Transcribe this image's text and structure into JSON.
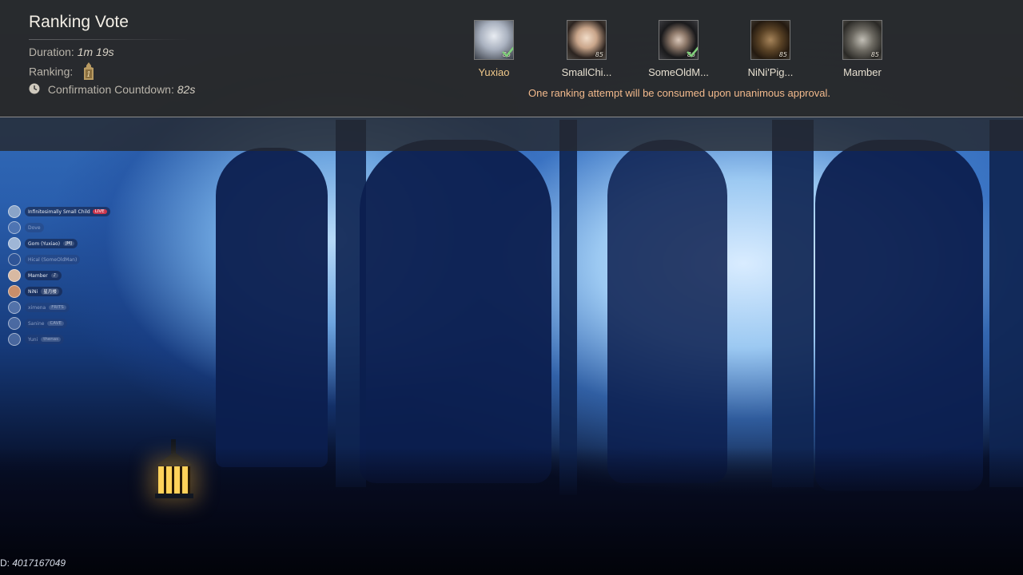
{
  "header": {
    "title": "Ranking Vote",
    "duration_label": "Duration:",
    "duration_value": "1m 19s",
    "ranking_label": "Ranking:",
    "ranking_icon": "rank-1-tablet-icon",
    "countdown_label": "Confirmation Countdown:",
    "countdown_value": "82s",
    "countdown_icon": "clock-icon"
  },
  "players": [
    {
      "name": "Yuxiao",
      "level": "86",
      "approved": true
    },
    {
      "name": "SmallChi...",
      "level": "85",
      "approved": false
    },
    {
      "name": "SomeOldM...",
      "level": "86",
      "approved": true
    },
    {
      "name": "NiNi'Pig...",
      "level": "85",
      "approved": false
    },
    {
      "name": "Mamber",
      "level": "85",
      "approved": false
    }
  ],
  "notice": "One ranking attempt will be consumed upon unanimous approval.",
  "voice_list": [
    {
      "name": "Infinitesimally Small Child",
      "tag": "LIVE",
      "active": true
    },
    {
      "name": "Dove",
      "tag": "",
      "active": false
    },
    {
      "name": "Gom (Yuxiao)",
      "tag": "JMJ",
      "active": true
    },
    {
      "name": "Hical (SomeOldMan)",
      "tag": "",
      "active": false
    },
    {
      "name": "Mamber",
      "tag": "♪",
      "active": true
    },
    {
      "name": "NiNi",
      "tag": "星月楼",
      "active": true
    },
    {
      "name": "ximena",
      "tag": "FRITS",
      "active": false
    },
    {
      "name": "Sanine",
      "tag": "CAVE",
      "active": false
    },
    {
      "name": "Yuni",
      "tag": "thenas",
      "active": false
    }
  ],
  "footer": {
    "id_label": "D:",
    "id_value": "4017167049"
  },
  "colors": {
    "panel_bg": "#282828",
    "accent_text": "#f2b98c",
    "approve_check": "#7fcf7a"
  }
}
